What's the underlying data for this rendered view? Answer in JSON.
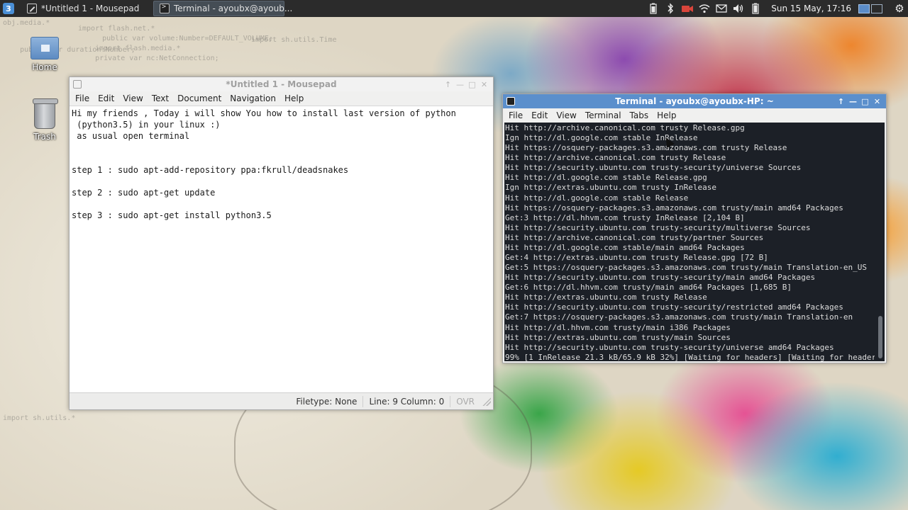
{
  "panel": {
    "tasks": [
      {
        "label": "*Untitled 1 - Mousepad"
      },
      {
        "label": "Terminal - ayoubx@ayoub..."
      }
    ],
    "clock": "Sun 15 May, 17:16"
  },
  "desktop": {
    "icons": [
      {
        "label": "Home"
      },
      {
        "label": "Trash"
      }
    ],
    "wallpaper_code": [
      "obj.media.*",
      "import flash.net.*",
      "    public var volume:Number=DEFAULT_VOLUME;",
      "    import flash.media.*",
      "    import sh.utils.Time",
      "    private var nc:NetConnection;",
      "    public var duration:Number;",
      "import sh.utils.*"
    ]
  },
  "mousepad": {
    "title": "*Untitled 1 - Mousepad",
    "menu": [
      "File",
      "Edit",
      "View",
      "Text",
      "Document",
      "Navigation",
      "Help"
    ],
    "content": "Hi my friends , Today i will show You how to install last version of python\n (python3.5) in your linux :)\n as usual open terminal\n\n\nstep 1 : sudo apt-add-repository ppa:fkrull/deadsnakes\n\nstep 2 : sudo apt-get update\n\nstep 3 : sudo apt-get install python3.5",
    "status": {
      "filetype": "Filetype: None",
      "position": "Line: 9 Column: 0",
      "mode": "OVR"
    }
  },
  "terminal": {
    "title": "Terminal - ayoubx@ayoubx-HP: ~",
    "menu": [
      "File",
      "Edit",
      "View",
      "Terminal",
      "Tabs",
      "Help"
    ],
    "lines": [
      "Hit http://archive.canonical.com trusty Release.gpg",
      "Ign http://dl.google.com stable InRelease",
      "Hit https://osquery-packages.s3.amazonaws.com trusty Release",
      "Hit http://archive.canonical.com trusty Release",
      "Hit http://security.ubuntu.com trusty-security/universe Sources",
      "Hit http://dl.google.com stable Release.gpg",
      "Ign http://extras.ubuntu.com trusty InRelease",
      "Hit http://dl.google.com stable Release",
      "Hit https://osquery-packages.s3.amazonaws.com trusty/main amd64 Packages",
      "Get:3 http://dl.hhvm.com trusty InRelease [2,104 B]",
      "Hit http://security.ubuntu.com trusty-security/multiverse Sources",
      "Hit http://archive.canonical.com trusty/partner Sources",
      "Hit http://dl.google.com stable/main amd64 Packages",
      "Get:4 http://extras.ubuntu.com trusty Release.gpg [72 B]",
      "Get:5 https://osquery-packages.s3.amazonaws.com trusty/main Translation-en_US",
      "Hit http://security.ubuntu.com trusty-security/main amd64 Packages",
      "Get:6 http://dl.hhvm.com trusty/main amd64 Packages [1,685 B]",
      "Hit http://extras.ubuntu.com trusty Release",
      "Hit http://security.ubuntu.com trusty-security/restricted amd64 Packages",
      "Get:7 https://osquery-packages.s3.amazonaws.com trusty/main Translation-en",
      "Hit http://dl.hhvm.com trusty/main i386 Packages",
      "Hit http://extras.ubuntu.com trusty/main Sources",
      "Hit http://security.ubuntu.com trusty-security/universe amd64 Packages"
    ],
    "progress_line": "99% [1 InRelease 21.3 kB/65.9 kB 32%] [Waiting for headers] [Waiting for header"
  }
}
